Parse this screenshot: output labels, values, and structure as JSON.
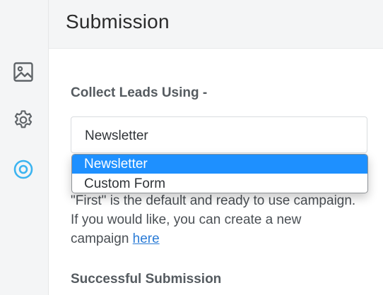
{
  "header": {
    "title": "Submission"
  },
  "sidebar": {
    "items": [
      {
        "icon": "image-icon",
        "active": false
      },
      {
        "icon": "gear-icon",
        "active": false
      },
      {
        "icon": "target-icon",
        "active": true
      }
    ],
    "active_color": "#3cb4f0",
    "inactive_color": "#5f6468"
  },
  "main": {
    "collect_heading": "Collect Leads Using -",
    "select": {
      "value": "Newsletter",
      "options": [
        "Newsletter",
        "Custom Form"
      ],
      "highlight_color": "#1e90ff"
    },
    "help": {
      "line1": "\"First\" is the default and ready to use campaign.",
      "line2": "If you would like, you can create a new",
      "line3_prefix": "campaign ",
      "link": "here"
    },
    "submission_heading": "Successful Submission"
  }
}
